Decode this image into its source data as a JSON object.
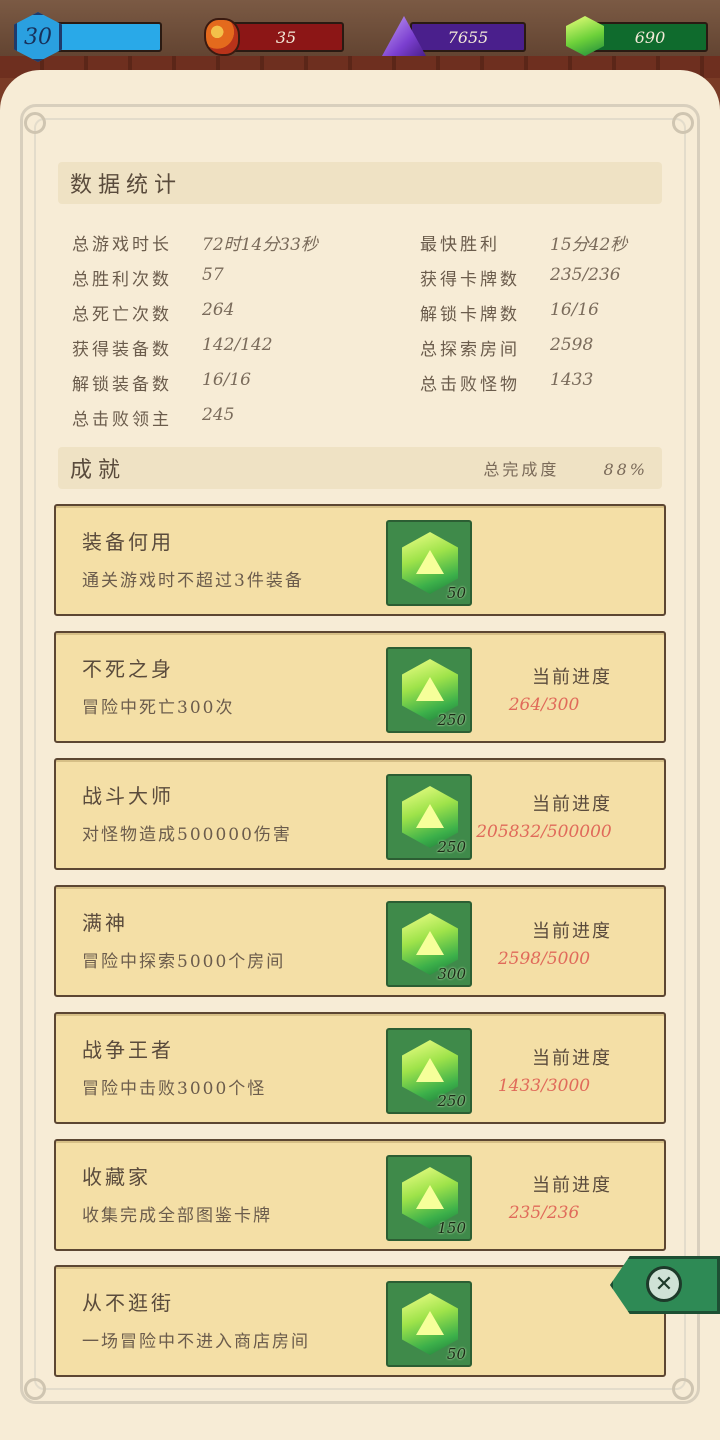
{
  "resources": {
    "level": "30",
    "red": "35",
    "purple": "7655",
    "green": "690"
  },
  "stats_section": {
    "title": "数据统计",
    "left": [
      {
        "label": "总游戏时长",
        "value": "72时14分33秒"
      },
      {
        "label": "总胜利次数",
        "value": "57"
      },
      {
        "label": "总死亡次数",
        "value": "264"
      },
      {
        "label": "获得装备数",
        "value": "142/142"
      },
      {
        "label": "解锁装备数",
        "value": "16/16"
      },
      {
        "label": "总击败领主",
        "value": "245"
      }
    ],
    "right": [
      {
        "label": "最快胜利",
        "value": "15分42秒"
      },
      {
        "label": "获得卡牌数",
        "value": "235/236"
      },
      {
        "label": "解锁卡牌数",
        "value": "16/16"
      },
      {
        "label": "总探索房间",
        "value": "2598"
      },
      {
        "label": "总击败怪物",
        "value": "1433"
      }
    ]
  },
  "achievements_section": {
    "title": "成就",
    "completion_label": "总完成度",
    "completion_value": "88%",
    "progress_label": "当前进度",
    "items": [
      {
        "name": "装备何用",
        "desc": "通关游戏时不超过3件装备",
        "reward": "50",
        "progress": ""
      },
      {
        "name": "不死之身",
        "desc": "冒险中死亡300次",
        "reward": "250",
        "progress": "264/300"
      },
      {
        "name": "战斗大师",
        "desc": "对怪物造成500000伤害",
        "reward": "250",
        "progress": "205832/500000"
      },
      {
        "name": "满神",
        "desc": "冒险中探索5000个房间",
        "reward": "300",
        "progress": "2598/5000"
      },
      {
        "name": "战争王者",
        "desc": "冒险中击败3000个怪",
        "reward": "250",
        "progress": "1433/3000"
      },
      {
        "name": "收藏家",
        "desc": "收集完成全部图鉴卡牌",
        "reward": "150",
        "progress": "235/236"
      },
      {
        "name": "从不逛街",
        "desc": "一场冒险中不进入商店房间",
        "reward": "50",
        "progress": ""
      }
    ]
  },
  "colors": {
    "parchment": "#f7ecd6",
    "card": "#f4dfa6",
    "progress_text": "#e06a5a",
    "close_tab": "#2e8a55"
  },
  "icons": {
    "level": "hexagon-badge",
    "red": "orange-ore-icon",
    "purple": "purple-crystal-icon",
    "green": "green-d20-gem-icon",
    "close": "close-icon"
  }
}
